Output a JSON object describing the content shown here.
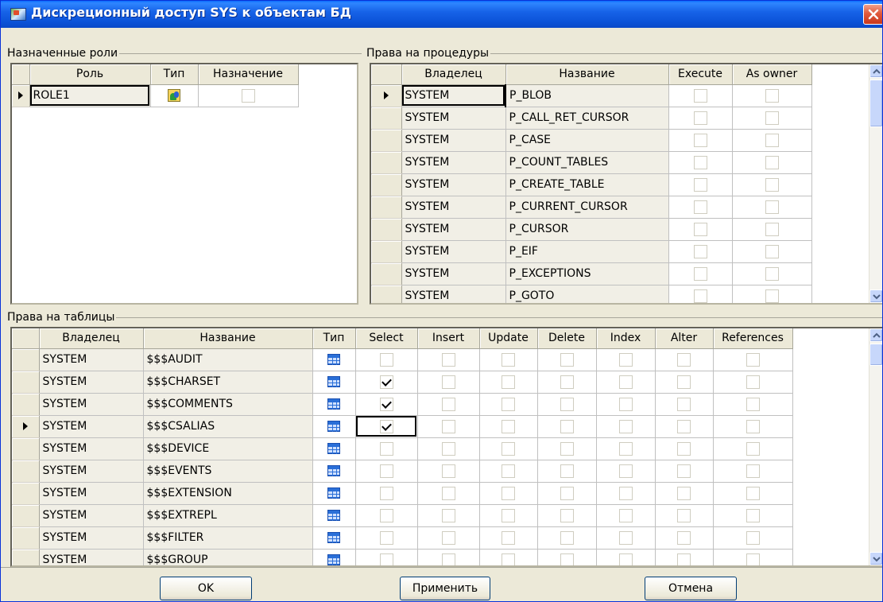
{
  "window": {
    "title": "Дискреционный доступ SYS к объектам БД"
  },
  "roles": {
    "group_label": "Назначенные роли",
    "headers": [
      "Роль",
      "Тип",
      "Назначение"
    ],
    "rows": [
      {
        "name": "ROLE1",
        "type_icon": "role-icon",
        "assigned": false,
        "current": true
      }
    ]
  },
  "procedures": {
    "group_label": "Права на процедуры",
    "headers": [
      "Владелец",
      "Название",
      "Execute",
      "As owner"
    ],
    "rows": [
      {
        "owner": "SYSTEM",
        "name": "P_BLOB",
        "execute": false,
        "as_owner": false,
        "current": true
      },
      {
        "owner": "SYSTEM",
        "name": "P_CALL_RET_CURSOR",
        "execute": false,
        "as_owner": false
      },
      {
        "owner": "SYSTEM",
        "name": "P_CASE",
        "execute": false,
        "as_owner": false
      },
      {
        "owner": "SYSTEM",
        "name": "P_COUNT_TABLES",
        "execute": false,
        "as_owner": false
      },
      {
        "owner": "SYSTEM",
        "name": "P_CREATE_TABLE",
        "execute": false,
        "as_owner": false
      },
      {
        "owner": "SYSTEM",
        "name": "P_CURRENT_CURSOR",
        "execute": false,
        "as_owner": false
      },
      {
        "owner": "SYSTEM",
        "name": "P_CURSOR",
        "execute": false,
        "as_owner": false
      },
      {
        "owner": "SYSTEM",
        "name": "P_EIF",
        "execute": false,
        "as_owner": false
      },
      {
        "owner": "SYSTEM",
        "name": "P_EXCEPTIONS",
        "execute": false,
        "as_owner": false
      },
      {
        "owner": "SYSTEM",
        "name": "P_GOTO",
        "execute": false,
        "as_owner": false
      }
    ]
  },
  "tables": {
    "group_label": "Права на таблицы",
    "headers": [
      "Владелец",
      "Название",
      "Тип",
      "Select",
      "Insert",
      "Update",
      "Delete",
      "Index",
      "Alter",
      "References"
    ],
    "rows": [
      {
        "owner": "SYSTEM",
        "name": "$$$AUDIT",
        "type_icon": "table-icon",
        "perms": [
          false,
          false,
          false,
          false,
          false,
          false,
          false
        ]
      },
      {
        "owner": "SYSTEM",
        "name": "$$$CHARSET",
        "type_icon": "table-icon",
        "perms": [
          true,
          false,
          false,
          false,
          false,
          false,
          false
        ]
      },
      {
        "owner": "SYSTEM",
        "name": "$$$COMMENTS",
        "type_icon": "table-icon",
        "perms": [
          true,
          false,
          false,
          false,
          false,
          false,
          false
        ]
      },
      {
        "owner": "SYSTEM",
        "name": "$$$CSALIAS",
        "type_icon": "table-icon",
        "perms": [
          true,
          false,
          false,
          false,
          false,
          false,
          false
        ],
        "current": true
      },
      {
        "owner": "SYSTEM",
        "name": "$$$DEVICE",
        "type_icon": "table-icon",
        "perms": [
          false,
          false,
          false,
          false,
          false,
          false,
          false
        ]
      },
      {
        "owner": "SYSTEM",
        "name": "$$$EVENTS",
        "type_icon": "table-icon",
        "perms": [
          false,
          false,
          false,
          false,
          false,
          false,
          false
        ]
      },
      {
        "owner": "SYSTEM",
        "name": "$$$EXTENSION",
        "type_icon": "table-icon",
        "perms": [
          false,
          false,
          false,
          false,
          false,
          false,
          false
        ]
      },
      {
        "owner": "SYSTEM",
        "name": "$$$EXTREPL",
        "type_icon": "table-icon",
        "perms": [
          false,
          false,
          false,
          false,
          false,
          false,
          false
        ]
      },
      {
        "owner": "SYSTEM",
        "name": "$$$FILTER",
        "type_icon": "table-icon",
        "perms": [
          false,
          false,
          false,
          false,
          false,
          false,
          false
        ]
      },
      {
        "owner": "SYSTEM",
        "name": "$$$GROUP",
        "type_icon": "table-icon",
        "perms": [
          false,
          false,
          false,
          false,
          false,
          false,
          false
        ]
      }
    ]
  },
  "buttons": {
    "ok": "OK",
    "apply": "Применить",
    "cancel": "Отмена"
  },
  "colors": {
    "titlebar": "#0b52d7",
    "face": "#ece9d8",
    "close": "#e05a3c"
  }
}
